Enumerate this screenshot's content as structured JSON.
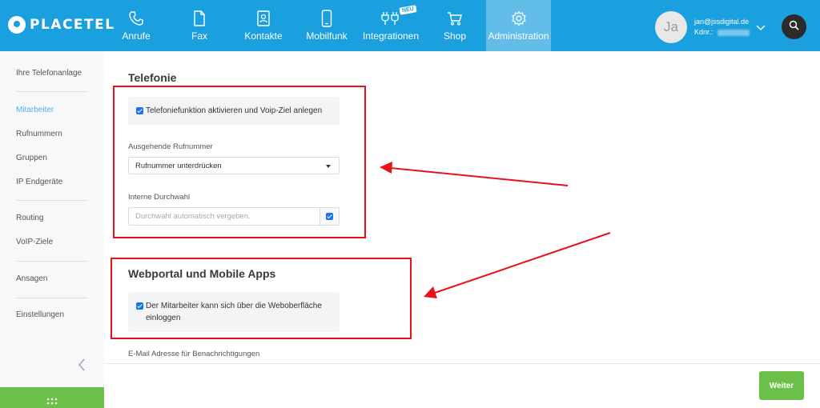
{
  "brand": {
    "name": "PLACETEL"
  },
  "nav": [
    {
      "label": "Anrufe",
      "icon": "phone-icon"
    },
    {
      "label": "Fax",
      "icon": "document-icon"
    },
    {
      "label": "Kontakte",
      "icon": "contact-card-icon"
    },
    {
      "label": "Mobilfunk",
      "icon": "mobile-phone-icon"
    },
    {
      "label": "Integrationen",
      "icon": "plug-icon",
      "badge": "NEU"
    },
    {
      "label": "Shop",
      "icon": "cart-icon"
    },
    {
      "label": "Administration",
      "icon": "gear-icon",
      "active": true
    }
  ],
  "user": {
    "avatar_initials": "Ja",
    "email": "jan@jssdigital.de",
    "kdnr_label": "Kdnr.:"
  },
  "sidebar": {
    "items": [
      {
        "label": "Ihre Telefonanlage"
      },
      {
        "label": "Mitarbeiter",
        "active": true
      },
      {
        "label": "Rufnummern"
      },
      {
        "label": "Gruppen"
      },
      {
        "label": "IP Endgeräte"
      },
      {
        "label": "Routing"
      },
      {
        "label": "VoIP-Ziele"
      },
      {
        "label": "Ansagen"
      },
      {
        "label": "Einstellungen"
      }
    ]
  },
  "telefonie": {
    "title": "Telefonie",
    "activate_label": "Telefoniefunktion aktivieren und Voip-Ziel anlegen",
    "activate_checked": true,
    "outgoing_label": "Ausgehende Rufnummer",
    "outgoing_value": "Rufnummer unterdrücken",
    "extension_label": "Interne Durchwahl",
    "extension_placeholder": "Durchwahl automatisch vergeben.",
    "extension_auto_checked": true
  },
  "webportal": {
    "title": "Webportal und Mobile Apps",
    "login_label_line1": "Der Mitarbeiter kann sich über die Weboberfläche",
    "login_label_line2": "einloggen",
    "login_checked": true,
    "email_label": "E-Mail Adresse für Benachrichtigungen"
  },
  "footer": {
    "next_label": "Weiter"
  },
  "colors": {
    "topbar": "#1a9fdf",
    "active_nav": "#63bde9",
    "accent_green": "#6cc04a",
    "annotation_red": "#e8121f"
  }
}
